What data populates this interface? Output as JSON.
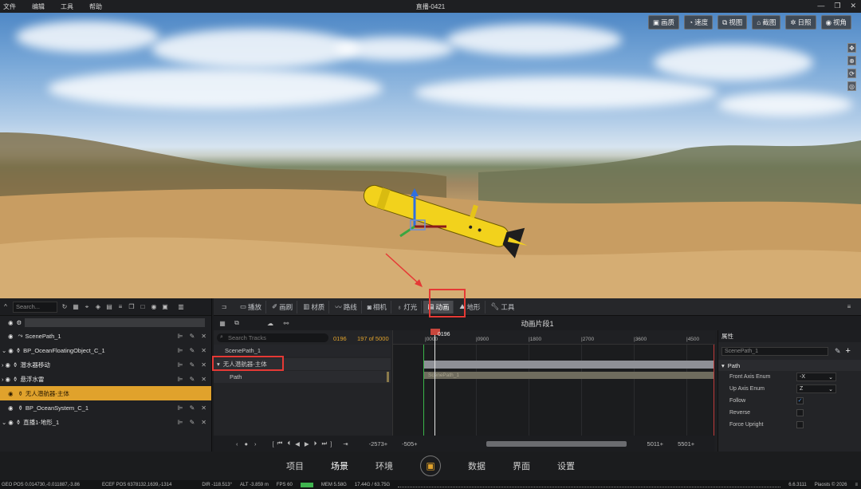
{
  "menu": {
    "items": [
      "文件",
      "编辑",
      "工具",
      "帮助"
    ],
    "title": "直播-0421"
  },
  "viewport": {
    "tools": [
      {
        "icon": "image-icon",
        "label": "画质"
      },
      {
        "icon": "speed-icon",
        "label": "速度"
      },
      {
        "icon": "view-icon",
        "label": "视图"
      },
      {
        "icon": "screenshot-icon",
        "label": "截图"
      },
      {
        "icon": "sun-icon",
        "label": "日照"
      },
      {
        "icon": "eye-icon",
        "label": "视角"
      }
    ],
    "side_icons": [
      "move-icon",
      "zoom-icon",
      "rotate-icon",
      "compass-icon"
    ]
  },
  "outliner": {
    "search_placeholder": "Search...",
    "filter_value": "",
    "items": [
      {
        "label": "ScenePath_1",
        "icon": "path-icon",
        "selected": false
      },
      {
        "label": "BP_OceanFloatingObject_C_1",
        "icon": "actor-icon",
        "selected": false
      },
      {
        "label": "潜水器移动",
        "icon": "actor-icon",
        "selected": false
      },
      {
        "label": "悬浮水雷",
        "icon": "actor-icon",
        "selected": false
      },
      {
        "label": "无人潜航器-主体",
        "icon": "actor-icon",
        "selected": true
      },
      {
        "label": "BP_OceanSystem_C_1",
        "icon": "actor-icon",
        "selected": false
      },
      {
        "label": "直播1-地形_1",
        "icon": "actor-icon",
        "selected": false
      }
    ]
  },
  "tabs": [
    {
      "label": "播放",
      "icon": "play-icon"
    },
    {
      "label": "画刷",
      "icon": "brush-icon"
    },
    {
      "label": "材质",
      "icon": "material-icon"
    },
    {
      "label": "路线",
      "icon": "route-icon"
    },
    {
      "label": "相机",
      "icon": "camera-icon"
    },
    {
      "label": "灯光",
      "icon": "light-icon"
    },
    {
      "label": "动画",
      "icon": "animation-icon",
      "active": true
    },
    {
      "label": "地形",
      "icon": "terrain-icon"
    },
    {
      "label": "工具",
      "icon": "tools-icon"
    }
  ],
  "sequencer": {
    "title": "动画片段1",
    "track_search_placeholder": "Search Tracks",
    "current_frame": "0196",
    "frame_count": "197 of 5000",
    "tracks": [
      "ScenePath_1",
      "无人潜航器-主体",
      "Path"
    ],
    "playhead_label": "0196",
    "ruler_ticks": [
      "|0000",
      "|0900",
      "|1800",
      "|2700",
      "|3600",
      "|4500"
    ],
    "section_label": "ScenePath_1",
    "range_start": "-2573+",
    "range_view_start": "-505+",
    "range_view_end": "5011+",
    "range_end": "5501+"
  },
  "properties": {
    "header": "属性",
    "name_value": "ScenePath_1",
    "section": "Path",
    "rows": [
      {
        "label": "Front Axis Enum",
        "type": "dropdown",
        "value": "-X"
      },
      {
        "label": "Up Axis Enum",
        "type": "dropdown",
        "value": "Z"
      },
      {
        "label": "Follow",
        "type": "checkbox",
        "checked": true
      },
      {
        "label": "Reverse",
        "type": "checkbox",
        "checked": false
      },
      {
        "label": "Force Upright",
        "type": "checkbox",
        "checked": false
      }
    ]
  },
  "bottom_nav": [
    "项目",
    "场景",
    "环境",
    "数据",
    "界面",
    "设置"
  ],
  "status": {
    "geo_pos": "GEO POS 0.014730,-0.011887,-3.86",
    "ecef_pos": "ECEF POS 6378132,1639,-1314",
    "dir": "DIR -118.513°",
    "alt": "ALT -3.859 m",
    "fps": "FPS 60",
    "mem": "MEM 5.58G",
    "mem2": "17.44G / 63.75G",
    "version": "6.6.3111",
    "brand": "Piaosts © 2026"
  },
  "colors": {
    "accent": "#e0a22c",
    "highlight": "#e53935"
  }
}
